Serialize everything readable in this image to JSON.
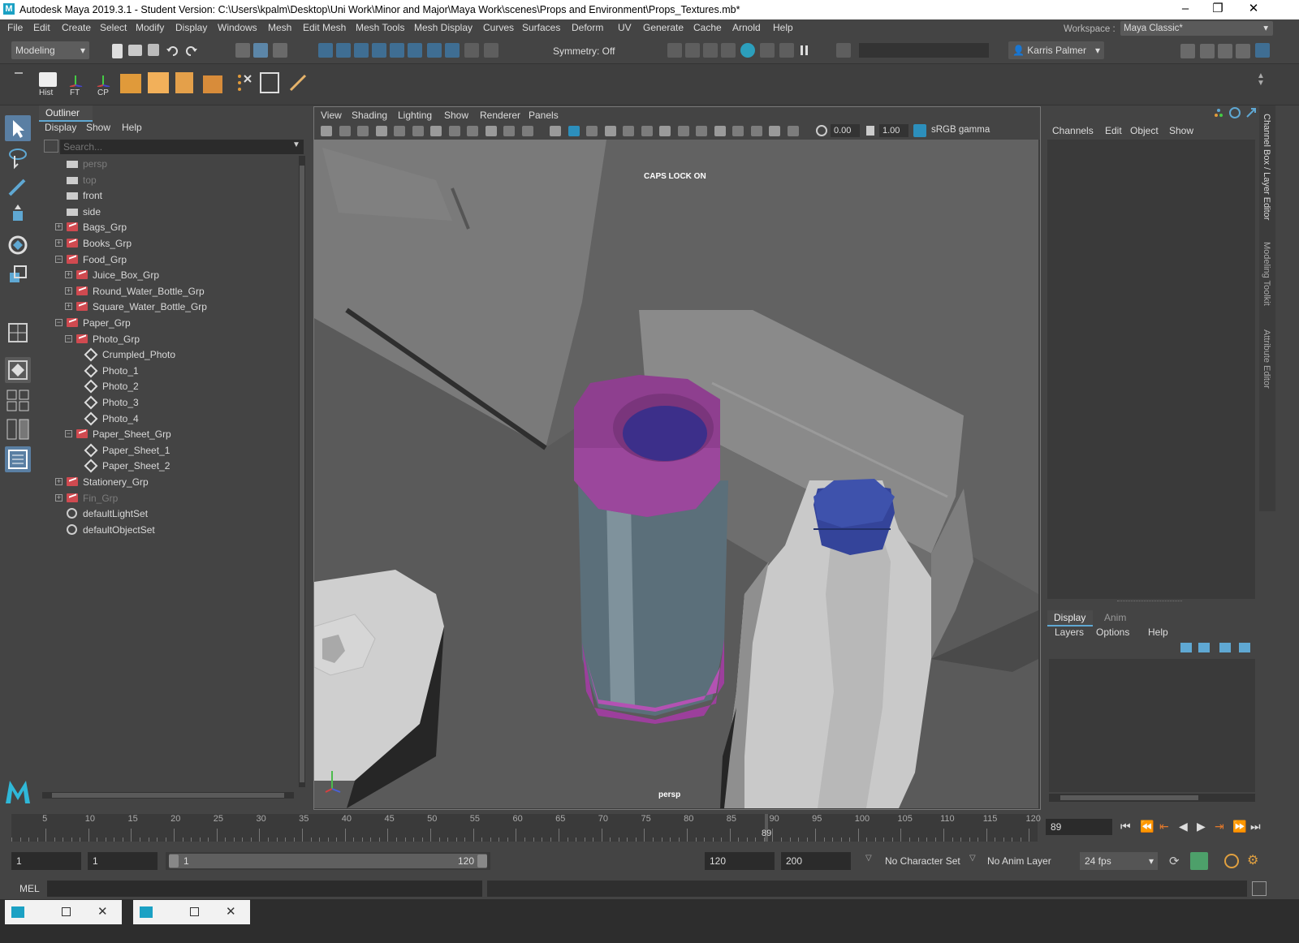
{
  "titlebar": {
    "logo": "M",
    "title": "Autodesk Maya 2019.3.1 - Student Version: C:\\Users\\kpalm\\Desktop\\Uni Work\\Minor and Major\\Maya Work\\scenes\\Props and Environment\\Props_Textures.mb*",
    "minimize": "–",
    "restore": "❐",
    "close": "✕"
  },
  "menubar": {
    "items": [
      "File",
      "Edit",
      "Create",
      "Select",
      "Modify",
      "Display",
      "Windows",
      "Mesh",
      "Edit Mesh",
      "Mesh Tools",
      "Mesh Display",
      "Curves",
      "Surfaces",
      "Deform",
      "UV",
      "Generate",
      "Cache",
      "Arnold",
      "Help"
    ],
    "workspace_label": "Workspace :",
    "workspace_value": "Maya Classic*"
  },
  "statusline": {
    "menuset": "Modeling",
    "symmetry": "Symmetry: Off",
    "user": "Karris Palmer"
  },
  "shelf": {
    "labels": [
      "Hist",
      "FT",
      "CP"
    ]
  },
  "outliner": {
    "title": "Outliner",
    "menus": [
      "Display",
      "Show",
      "Help"
    ],
    "search_placeholder": "Search...",
    "items": [
      {
        "label": "persp",
        "indent": 0,
        "icon": "camera-icon",
        "dim": true,
        "expander": ""
      },
      {
        "label": "top",
        "indent": 0,
        "icon": "camera-icon",
        "dim": true,
        "expander": ""
      },
      {
        "label": "front",
        "indent": 0,
        "icon": "camera-icon",
        "dim": false,
        "expander": ""
      },
      {
        "label": "side",
        "indent": 0,
        "icon": "camera-icon",
        "dim": false,
        "expander": ""
      },
      {
        "label": "Bags_Grp",
        "indent": 0,
        "icon": "group-icon",
        "dim": false,
        "expander": "+"
      },
      {
        "label": "Books_Grp",
        "indent": 0,
        "icon": "group-icon",
        "dim": false,
        "expander": "+"
      },
      {
        "label": "Food_Grp",
        "indent": 0,
        "icon": "group-icon",
        "dim": false,
        "expander": "−"
      },
      {
        "label": "Juice_Box_Grp",
        "indent": 1,
        "icon": "group-icon",
        "dim": false,
        "expander": "+"
      },
      {
        "label": "Round_Water_Bottle_Grp",
        "indent": 1,
        "icon": "group-icon",
        "dim": false,
        "expander": "+"
      },
      {
        "label": "Square_Water_Bottle_Grp",
        "indent": 1,
        "icon": "group-icon",
        "dim": false,
        "expander": "+"
      },
      {
        "label": "Paper_Grp",
        "indent": 0,
        "icon": "group-icon",
        "dim": false,
        "expander": "−"
      },
      {
        "label": "Photo_Grp",
        "indent": 1,
        "icon": "group-icon",
        "dim": false,
        "expander": "−"
      },
      {
        "label": "Crumpled_Photo",
        "indent": 2,
        "icon": "mesh-icon",
        "dim": false,
        "expander": ""
      },
      {
        "label": "Photo_1",
        "indent": 2,
        "icon": "mesh-icon",
        "dim": false,
        "expander": ""
      },
      {
        "label": "Photo_2",
        "indent": 2,
        "icon": "mesh-icon",
        "dim": false,
        "expander": ""
      },
      {
        "label": "Photo_3",
        "indent": 2,
        "icon": "mesh-icon",
        "dim": false,
        "expander": ""
      },
      {
        "label": "Photo_4",
        "indent": 2,
        "icon": "mesh-icon",
        "dim": false,
        "expander": ""
      },
      {
        "label": "Paper_Sheet_Grp",
        "indent": 1,
        "icon": "group-icon",
        "dim": false,
        "expander": "−"
      },
      {
        "label": "Paper_Sheet_1",
        "indent": 2,
        "icon": "mesh-icon",
        "dim": false,
        "expander": ""
      },
      {
        "label": "Paper_Sheet_2",
        "indent": 2,
        "icon": "mesh-icon",
        "dim": false,
        "expander": ""
      },
      {
        "label": "Stationery_Grp",
        "indent": 0,
        "icon": "group-icon",
        "dim": false,
        "expander": "+"
      },
      {
        "label": "Fin_Grp",
        "indent": 0,
        "icon": "group-icon",
        "dim": true,
        "expander": "+"
      },
      {
        "label": "defaultLightSet",
        "indent": 0,
        "icon": "set-icon",
        "dim": false,
        "expander": ""
      },
      {
        "label": "defaultObjectSet",
        "indent": 0,
        "icon": "set-icon",
        "dim": false,
        "expander": ""
      }
    ]
  },
  "viewport": {
    "menus": [
      "View",
      "Shading",
      "Lighting",
      "Show",
      "Renderer",
      "Panels"
    ],
    "exposure": "0.00",
    "gamma": "1.00",
    "color_space": "sRGB gamma",
    "caps_lock": "CAPS LOCK ON",
    "camera": "persp"
  },
  "channelbox": {
    "menus": [
      "Channels",
      "Edit",
      "Object",
      "Show"
    ],
    "side_tabs": [
      "Channel Box / Layer Editor",
      "Modeling Toolkit",
      "Attribute Editor"
    ]
  },
  "layereditor": {
    "tabs": [
      "Display",
      "Anim"
    ],
    "menus": [
      "Layers",
      "Options",
      "Help"
    ]
  },
  "timeline": {
    "ticks": [
      "5",
      "10",
      "15",
      "20",
      "25",
      "30",
      "35",
      "40",
      "45",
      "50",
      "55",
      "60",
      "65",
      "70",
      "75",
      "80",
      "85",
      "90",
      "95",
      "100",
      "105",
      "110",
      "115",
      "120"
    ],
    "current_frame": "89",
    "current_frame_field": "89"
  },
  "range": {
    "start": "1",
    "playback_start": "1",
    "slider_start": "1",
    "slider_end": "120",
    "playback_end": "120",
    "end": "200",
    "character_set": "No Character Set",
    "anim_layer": "No Anim Layer",
    "fps": "24 fps"
  },
  "commandline": {
    "label": "MEL"
  },
  "colors": {
    "cap_purple": "#8e3f8f",
    "bottle_blue": "#5b6f7a",
    "cap_blue": "#3a4ea0",
    "accent": "#5fa8d3"
  }
}
